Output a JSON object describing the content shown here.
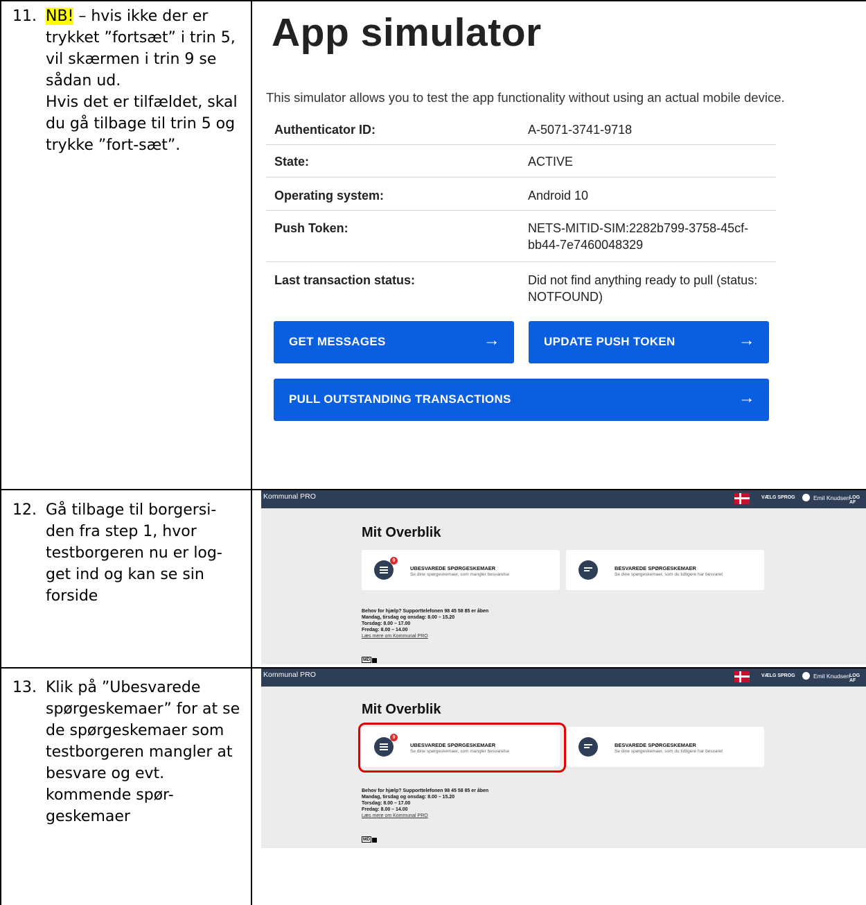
{
  "steps": [
    {
      "number": "11.",
      "highlight": "NB!",
      "text": " – hvis ikke der er trykket ”fortsæt” i trin 5, vil skærmen i trin 9 se sådan ud.\nHvis det er tilfældet, skal du gå tilbage til trin 5 og trykke ”fort-sæt”."
    },
    {
      "number": "12.",
      "text": "Gå tilbage til borgersi-den fra step 1, hvor testborgeren nu er log-get ind og kan se sin forside"
    },
    {
      "number": "13.",
      "text": "Klik på ”Ubesvarede spørgeskemaer” for at se de spørgeskemaer som testborgeren mangler at besvare og evt. kommende spør-geskemaer"
    }
  ],
  "app_simulator": {
    "title": "App simulator",
    "description": "This simulator allows you to test the app functionality without using an actual mobile device.",
    "rows": [
      {
        "key": "Authenticator ID:",
        "value": "A-5071-3741-9718"
      },
      {
        "key": "State:",
        "value": "ACTIVE"
      },
      {
        "key": "Operating system:",
        "value": "Android 10"
      },
      {
        "key": "Push Token:",
        "value": "NETS-MITID-SIM:2282b799-3758-45cf-bb44-7e7460048329"
      },
      {
        "key": "Last transaction status:",
        "value": "Did not find anything ready to pull (status: NOTFOUND)"
      }
    ],
    "buttons": {
      "get_messages": "GET MESSAGES",
      "update_push_token": "UPDATE PUSH TOKEN",
      "pull_outstanding": "PULL OUTSTANDING TRANSACTIONS",
      "arrow": "→"
    },
    "accent_color": "#0a5ee0"
  },
  "kommunal_pro": {
    "brand": "Kommunal PRO",
    "language": "VÆLG SPROG",
    "user": "Emil Knudsen",
    "logout": "LOG AF",
    "heading": "Mit Overblik",
    "cards": [
      {
        "title": "UBESVAREDE SPØRGESKEMAER",
        "subtitle": "Se dine spørgeskemaer, som mangler besvarelse",
        "badge": "9"
      },
      {
        "title": "BESVAREDE SPØRGESKEMAER",
        "subtitle": "Se dine spørgeskemaer, som du tidligere har besvaret"
      }
    ],
    "help": {
      "line1": "Behov for hjælp? Supporttelefonen 98 45 58 85 er åben",
      "line2": "Mandag, tirsdag og onsdag: 8.00 – 15.20",
      "line3": "Torsdag: 8.00 – 17.00",
      "line4": "Fredag: 8.00 – 14.00",
      "link": "Læs mere om Kommunal PRO"
    },
    "md_label": "MD",
    "bar_color": "#2f3e57",
    "highlight_color": "#e00000"
  }
}
